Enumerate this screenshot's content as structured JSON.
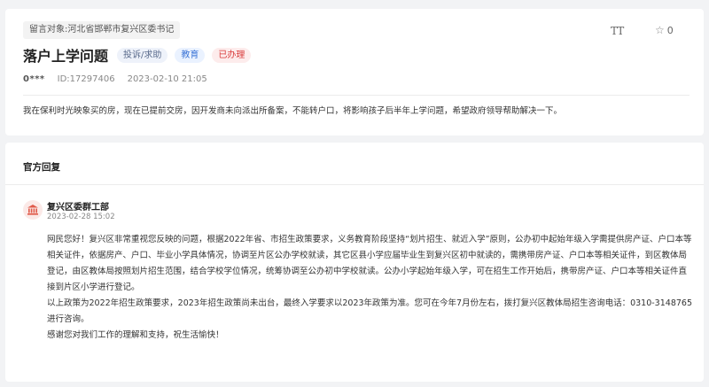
{
  "message": {
    "target_label": "留言对象:",
    "target": "河北省邯郸市复兴区委书记",
    "font_toggle": "TT",
    "star_count": "0",
    "title": "落户上学问题",
    "tags": {
      "type": "投诉/求助",
      "domain": "教育",
      "status": "已办理"
    },
    "user": "0***",
    "id": "ID:17297406",
    "time": "2023-02-10 21:05",
    "content": "我在保利时光映象买的房，现在已提前交房，因开发商未向派出所备案，不能转户口，将影响孩子后半年上学问题，希望政府领导帮助解决一下。"
  },
  "reply": {
    "section_title": "官方回复",
    "department": "复兴区委群工部",
    "time": "2023-02-28 15:02",
    "paragraphs": [
      "网民您好！复兴区非常重视您反映的问题，根据2022年省、市招生政策要求，义务教育阶段坚持“划片招生、就近入学”原则，公办初中起始年级入学需提供房产证、户口本等相关证件，依据房产、户口、毕业小学具体情况，协调至片区公办学校就读，其它区县小学应届毕业生到复兴区初中就读的，需携带房产证、户口本等相关证件，到区教体局登记，由区教体局按照划片招生范围，结合学校学位情况，统筹协调至公办初中学校就读。公办小学起始年级入学，可在招生工作开始后，携带房产证、户口本等相关证件直接到片区小学进行登记。",
      "以上政策为2022年招生政策要求，2023年招生政策尚未出台，最终入学要求以2023年政策为准。您可在今年7月份左右，拨打复兴区教体局招生咨询电话：0310-3148765进行咨询。",
      "感谢您对我们工作的理解和支持，祝生活愉快！"
    ]
  },
  "icons": {
    "star": "star-outline-icon",
    "font": "font-size-icon",
    "avatar": "government-building-icon"
  },
  "colors": {
    "status_red": "#d93b3b",
    "domain_blue": "#3b74d6",
    "avatar_red": "#e05a4a"
  }
}
